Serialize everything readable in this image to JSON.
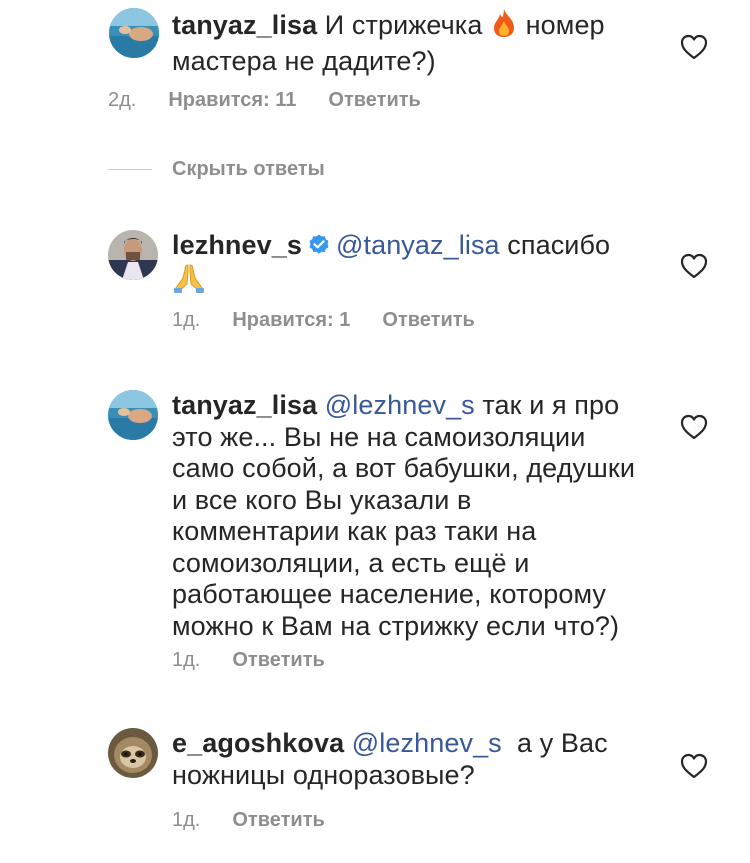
{
  "comments": [
    {
      "username": "tanyaz_lisa",
      "text_a": " И стрижечка ",
      "text_b": " номер мастера не дадите?)",
      "timestamp": "2д.",
      "likes": "Нравится: 11",
      "reply": "Ответить"
    },
    {
      "username": "lezhnev_s",
      "mention": "@tanyaz_lisa",
      "text": " спасибо",
      "timestamp": "1д.",
      "likes": "Нравится: 1",
      "reply": "Ответить"
    },
    {
      "username": "tanyaz_lisa",
      "mention": "@lezhnev_s",
      "text": " так и я про это же... Вы не на самоизоляции само собой, а вот бабушки, дедушки и все кого Вы указали в комментарии как раз таки на сомоизоляции, а есть ещё и работающее население, которому можно к Вам на стрижку если что?)",
      "timestamp": "1д.",
      "reply": "Ответить"
    },
    {
      "username": "e_agoshkova",
      "mention": "@lezhnev_s",
      "text": "  а у Вас ножницы одноразовые?",
      "timestamp": "1д.",
      "reply": "Ответить"
    }
  ],
  "hide_replies": "Скрыть ответы",
  "icons": {
    "like": "heart-outline-icon",
    "verified": "verified-badge-icon",
    "fire": "fire-emoji",
    "pray": "folded-hands-emoji"
  },
  "colors": {
    "text": "#262626",
    "meta": "#8e8e8e",
    "mention": "#385898",
    "verified": "#3897f0"
  }
}
